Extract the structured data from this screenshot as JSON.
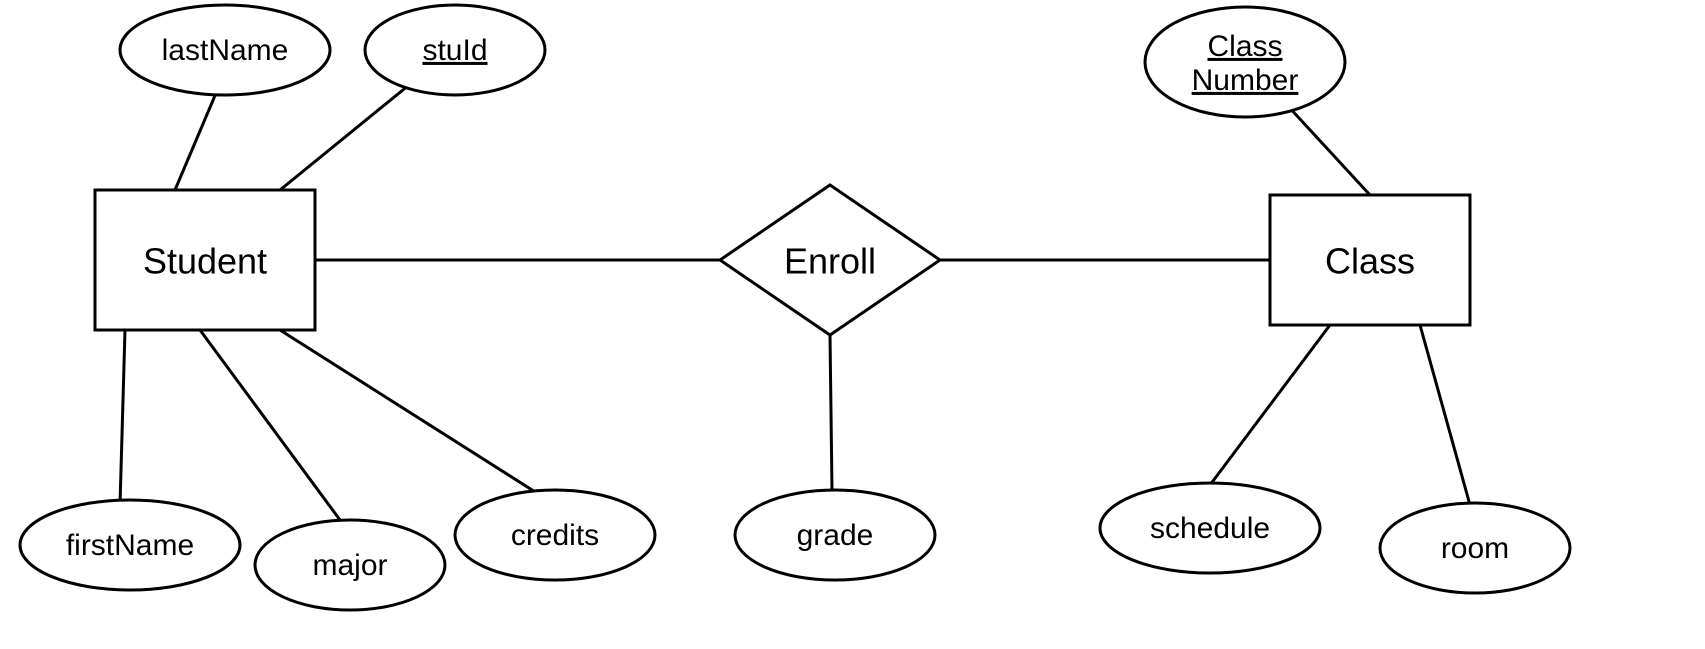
{
  "entities": {
    "student": {
      "label": "Student"
    },
    "class": {
      "label": "Class"
    }
  },
  "relationship": {
    "enroll": {
      "label": "Enroll"
    }
  },
  "attributes": {
    "lastName": {
      "label": "lastName",
      "key": false
    },
    "stuId": {
      "label": "stuId",
      "key": true
    },
    "firstName": {
      "label": "firstName",
      "key": false
    },
    "major": {
      "label": "major",
      "key": false
    },
    "credits": {
      "label": "credits",
      "key": false
    },
    "grade": {
      "label": "grade",
      "key": false
    },
    "classNumber": {
      "label1": "Class",
      "label2": "Number",
      "key": true
    },
    "schedule": {
      "label": "schedule",
      "key": false
    },
    "room": {
      "label": "room",
      "key": false
    }
  }
}
